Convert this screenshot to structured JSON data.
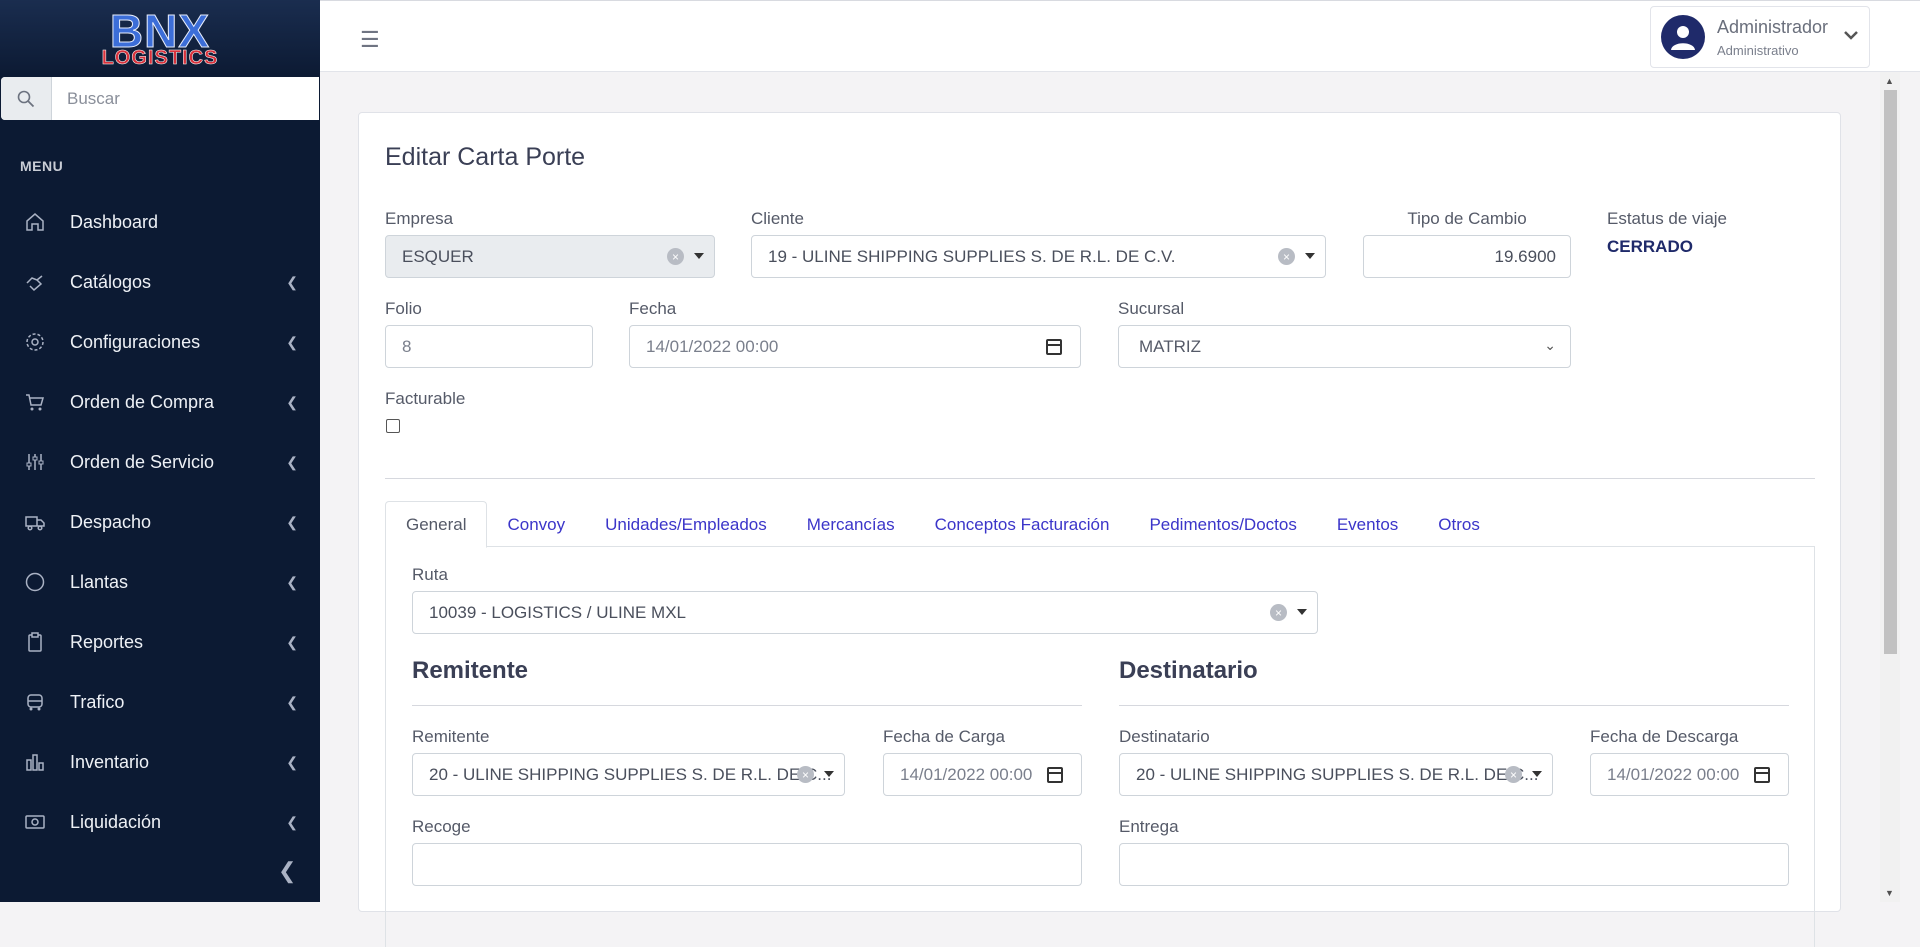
{
  "brand": {
    "logo_top": "BNX",
    "logo_bottom": "LOGISTICS"
  },
  "search": {
    "placeholder": "Buscar"
  },
  "sidebar": {
    "menu_label": "MENU",
    "items": [
      {
        "label": "Dashboard",
        "icon": "home-icon"
      },
      {
        "label": "Catálogos",
        "icon": "hand-icon"
      },
      {
        "label": "Configuraciones",
        "icon": "gear-icon"
      },
      {
        "label": "Orden de Compra",
        "icon": "cart-icon"
      },
      {
        "label": "Orden de Servicio",
        "icon": "sliders-icon"
      },
      {
        "label": "Despacho",
        "icon": "truck-icon"
      },
      {
        "label": "Llantas",
        "icon": "circle-icon"
      },
      {
        "label": "Reportes",
        "icon": "clipboard-icon"
      },
      {
        "label": "Trafico",
        "icon": "bus-icon"
      },
      {
        "label": "Inventario",
        "icon": "bar-chart-icon"
      },
      {
        "label": "Liquidación",
        "icon": "money-icon"
      }
    ]
  },
  "user": {
    "name": "Administrador",
    "role": "Administrativo"
  },
  "form": {
    "title": "Editar Carta Porte",
    "empresa": {
      "label": "Empresa",
      "value": "ESQUER"
    },
    "cliente": {
      "label": "Cliente",
      "value": "19 - ULINE SHIPPING SUPPLIES S. DE R.L. DE C.V."
    },
    "tipo_cambio": {
      "label": "Tipo de Cambio",
      "value": "19.6900"
    },
    "estatus": {
      "label": "Estatus de viaje",
      "value": "CERRADO"
    },
    "folio": {
      "label": "Folio",
      "value": "8"
    },
    "fecha": {
      "label": "Fecha",
      "value": "14/01/2022  00:00"
    },
    "sucursal": {
      "label": "Sucursal",
      "value": "MATRIZ"
    },
    "facturable": {
      "label": "Facturable",
      "checked": false
    }
  },
  "tabs": [
    "General",
    "Convoy",
    "Unidades/Empleados",
    "Mercancías",
    "Conceptos Facturación",
    "Pedimentos/Doctos",
    "Eventos",
    "Otros"
  ],
  "general": {
    "ruta": {
      "label": "Ruta",
      "value": "10039 - LOGISTICS / ULINE MXL"
    },
    "remitente_title": "Remitente",
    "destinatario_title": "Destinatario",
    "remitente": {
      "label": "Remitente",
      "value": "20 - ULINE SHIPPING SUPPLIES S. DE R.L. DE C..."
    },
    "fecha_carga": {
      "label": "Fecha de Carga",
      "value": "14/01/2022  00:00"
    },
    "destinatario": {
      "label": "Destinatario",
      "value": "20 - ULINE SHIPPING SUPPLIES S. DE R.L. DE C..."
    },
    "fecha_descarga": {
      "label": "Fecha de Descarga",
      "value": "14/01/2022  00:00"
    },
    "recoge": {
      "label": "Recoge",
      "value": ""
    },
    "entrega": {
      "label": "Entrega",
      "value": ""
    }
  }
}
